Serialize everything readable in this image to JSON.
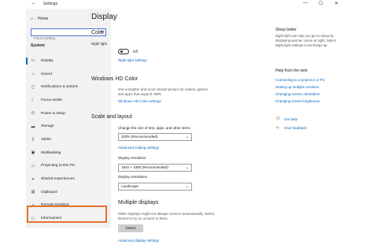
{
  "window": {
    "title": "Settings",
    "controls": [
      "—",
      "☐",
      "✕"
    ]
  },
  "sidebar": {
    "home": "Home",
    "search_placeholder": "Find a setting",
    "section": "System",
    "items": [
      {
        "label": "Display",
        "icon": "display-icon"
      },
      {
        "label": "Sound",
        "icon": "speaker-icon"
      },
      {
        "label": "Notifications & actions",
        "icon": "notification-icon"
      },
      {
        "label": "Focus assist",
        "icon": "moon-icon"
      },
      {
        "label": "Power & sleep",
        "icon": "power-icon"
      },
      {
        "label": "Storage",
        "icon": "storage-icon"
      },
      {
        "label": "Tablet",
        "icon": "tablet-icon"
      },
      {
        "label": "Multitasking",
        "icon": "multitasking-icon"
      },
      {
        "label": "Projecting to this PC",
        "icon": "projector-icon"
      },
      {
        "label": "Shared experiences",
        "icon": "shared-icon"
      },
      {
        "label": "Clipboard",
        "icon": "clipboard-icon"
      },
      {
        "label": "Remote Desktop",
        "icon": "remote-icon"
      },
      {
        "label": "Informazioni",
        "icon": "info-icon"
      }
    ]
  },
  "main": {
    "title": "Display",
    "color_heading": "Color",
    "night_light_label": "Night light",
    "night_light_state": "Off",
    "night_light_settings": "Night light settings",
    "hd_heading": "Windows HD Color",
    "hd_desc": "Get a brighter and more vibrant picture for videos, games and apps that support HDR.",
    "hd_settings": "Windows HD Color settings",
    "scale_heading": "Scale and layout",
    "scale_label": "Change the size of text, apps, and other items",
    "scale_value": "100% (Recommended)",
    "advanced_scaling": "Advanced scaling settings",
    "resolution_label": "Display resolution",
    "resolution_value": "1920 × 1080 (Recommended)",
    "orientation_label": "Display orientation",
    "orientation_value": "Landscape",
    "multi_heading": "Multiple displays",
    "multi_desc": "Older displays might not always connect automatically. Select Detect to try to connect to them.",
    "detect_button": "Detect",
    "advanced_display": "Advanced display settings"
  },
  "right": {
    "sleep_heading": "Sleep better",
    "sleep_desc": "Night light can help you get to sleep by displaying warmer colors at night. Select Night light settings to set things up.",
    "help_heading": "Help from the web",
    "links": [
      "Connecting to a projector or PC",
      "Setting up multiple monitors",
      "Changing screen orientation",
      "Changing screen brightness"
    ],
    "get_help": "Get help",
    "feedback": "Give feedback"
  },
  "accent": "#0067c0",
  "highlight_color": "#e8702a"
}
